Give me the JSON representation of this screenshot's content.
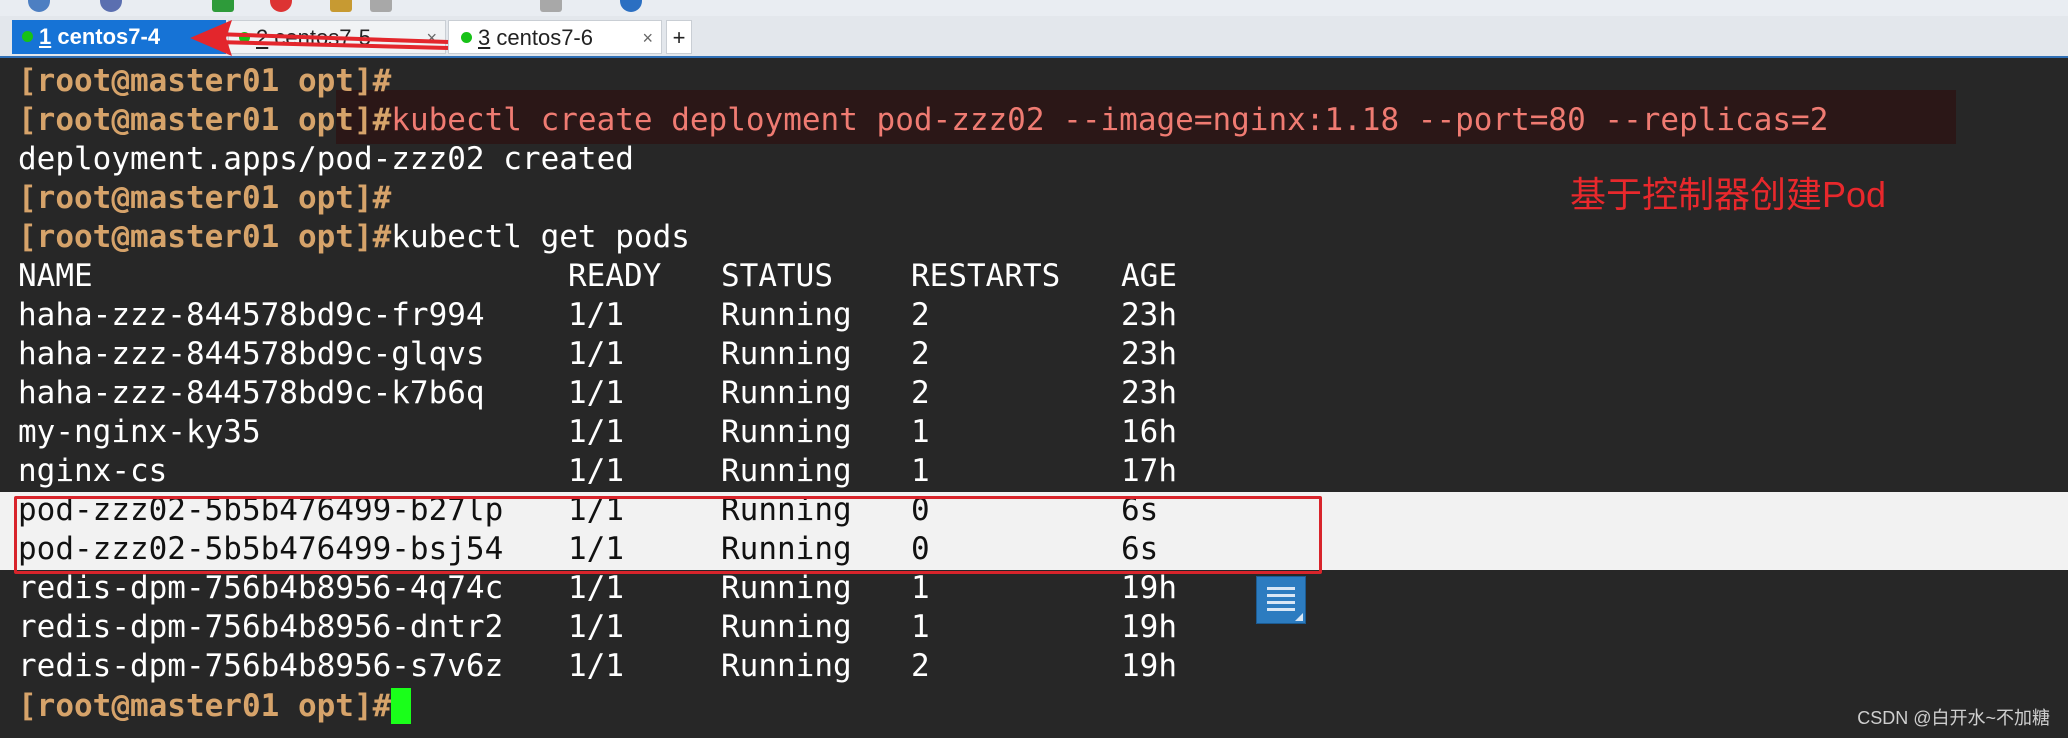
{
  "tabs": [
    {
      "number": "1",
      "title": "centos7-4",
      "active": true
    },
    {
      "number": "2",
      "title": "centos7-5",
      "active": false
    },
    {
      "number": "3",
      "title": "centos7-6",
      "active": false
    }
  ],
  "tab_close_glyph": "×",
  "tab_add_glyph": "+",
  "terminal": {
    "prompt": "[root@master01 opt]#",
    "cmd_create": "kubectl create deployment pod-zzz02 --image=nginx:1.18 --port=80 --replicas=2",
    "out_created": "deployment.apps/pod-zzz02 created",
    "cmd_get": "kubectl get pods",
    "headers": [
      "NAME",
      "READY",
      "STATUS",
      "RESTARTS",
      "AGE"
    ],
    "rows": [
      {
        "name": "haha-zzz-844578bd9c-fr994",
        "ready": "1/1",
        "status": "Running",
        "restarts": "2",
        "age": "23h"
      },
      {
        "name": "haha-zzz-844578bd9c-glqvs",
        "ready": "1/1",
        "status": "Running",
        "restarts": "2",
        "age": "23h"
      },
      {
        "name": "haha-zzz-844578bd9c-k7b6q",
        "ready": "1/1",
        "status": "Running",
        "restarts": "2",
        "age": "23h"
      },
      {
        "name": "my-nginx-ky35",
        "ready": "1/1",
        "status": "Running",
        "restarts": "1",
        "age": "16h"
      },
      {
        "name": "nginx-cs",
        "ready": "1/1",
        "status": "Running",
        "restarts": "1",
        "age": "17h"
      },
      {
        "name": "pod-zzz02-5b5b476499-b27lp",
        "ready": "1/1",
        "status": "Running",
        "restarts": "0",
        "age": "6s"
      },
      {
        "name": "pod-zzz02-5b5b476499-bsj54",
        "ready": "1/1",
        "status": "Running",
        "restarts": "0",
        "age": "6s"
      },
      {
        "name": "redis-dpm-756b4b8956-4q74c",
        "ready": "1/1",
        "status": "Running",
        "restarts": "1",
        "age": "19h"
      },
      {
        "name": "redis-dpm-756b4b8956-dntr2",
        "ready": "1/1",
        "status": "Running",
        "restarts": "1",
        "age": "19h"
      },
      {
        "name": "redis-dpm-756b4b8956-s7v6z",
        "ready": "1/1",
        "status": "Running",
        "restarts": "2",
        "age": "19h"
      }
    ]
  },
  "annotation": "基于控制器创建Pod",
  "watermark": "CSDN @白开水~不加糖",
  "icons": {
    "tab_status": "green-dot-icon",
    "doc": "document-icon"
  },
  "colors": {
    "terminal_bg": "#272727",
    "prompt": "#d6a36a",
    "highlight_command": "#ef7b72",
    "active_tab": "#1673d6",
    "annotation": "#e8282c",
    "cursor": "#1aff1a"
  }
}
